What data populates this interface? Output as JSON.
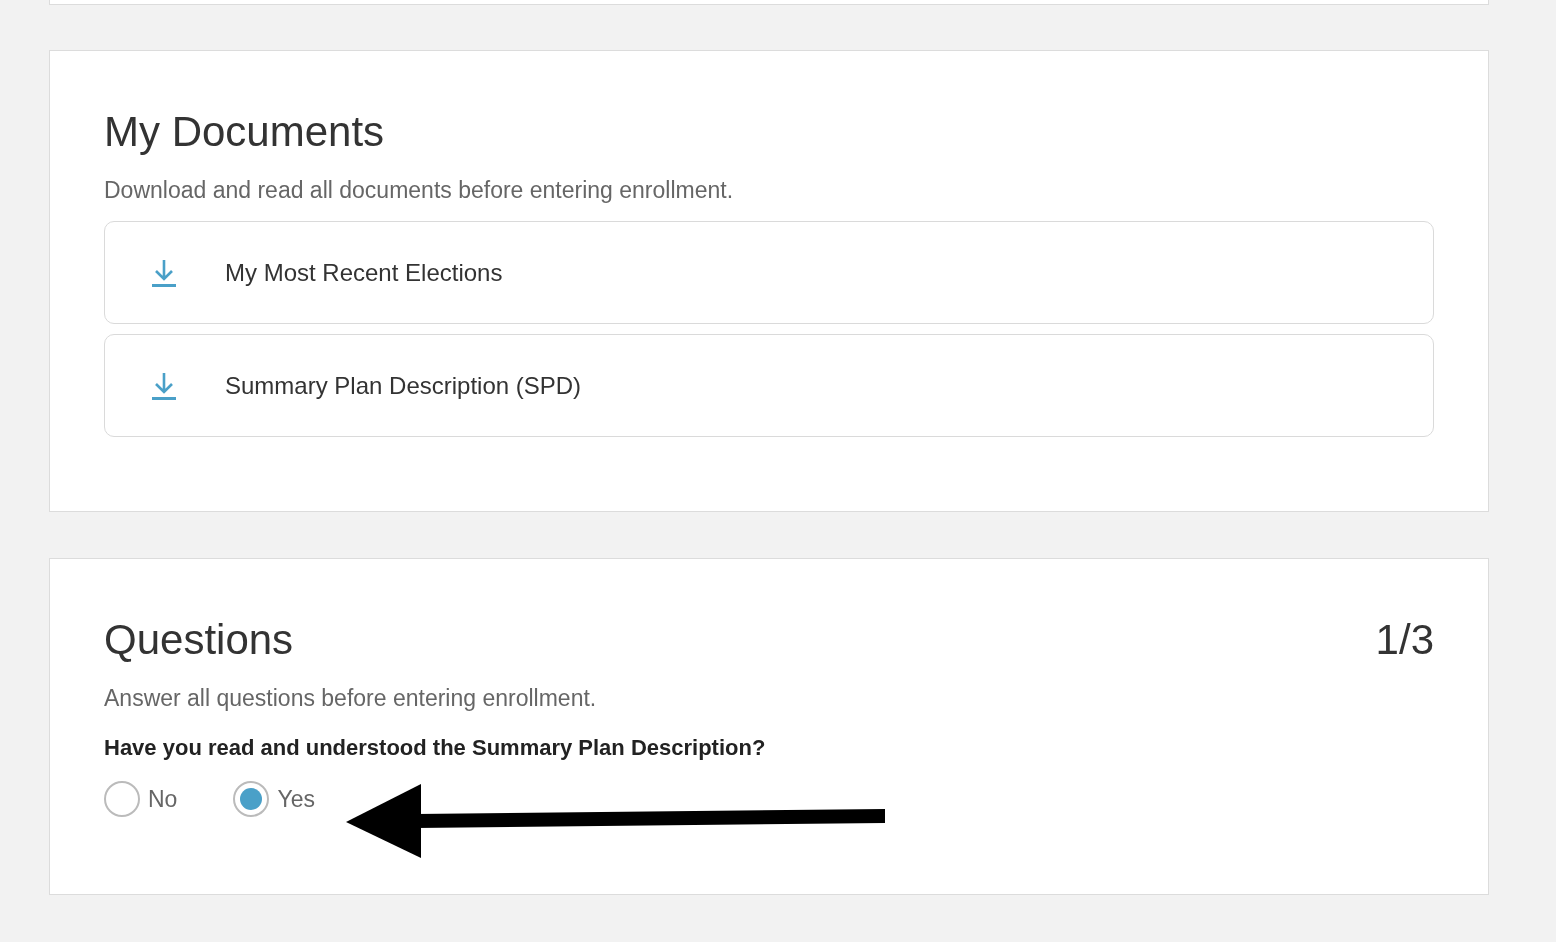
{
  "documents": {
    "title": "My Documents",
    "subtitle": "Download and read all documents before entering enrollment.",
    "items": [
      {
        "label": "My Most Recent Elections"
      },
      {
        "label": "Summary Plan Description (SPD)"
      }
    ]
  },
  "questions": {
    "title": "Questions",
    "progress": "1/3",
    "subtitle": "Answer all questions before entering enrollment.",
    "question": "Have you read and understood the Summary Plan Description?",
    "options": [
      {
        "label": "No",
        "selected": false
      },
      {
        "label": "Yes",
        "selected": true
      }
    ]
  }
}
